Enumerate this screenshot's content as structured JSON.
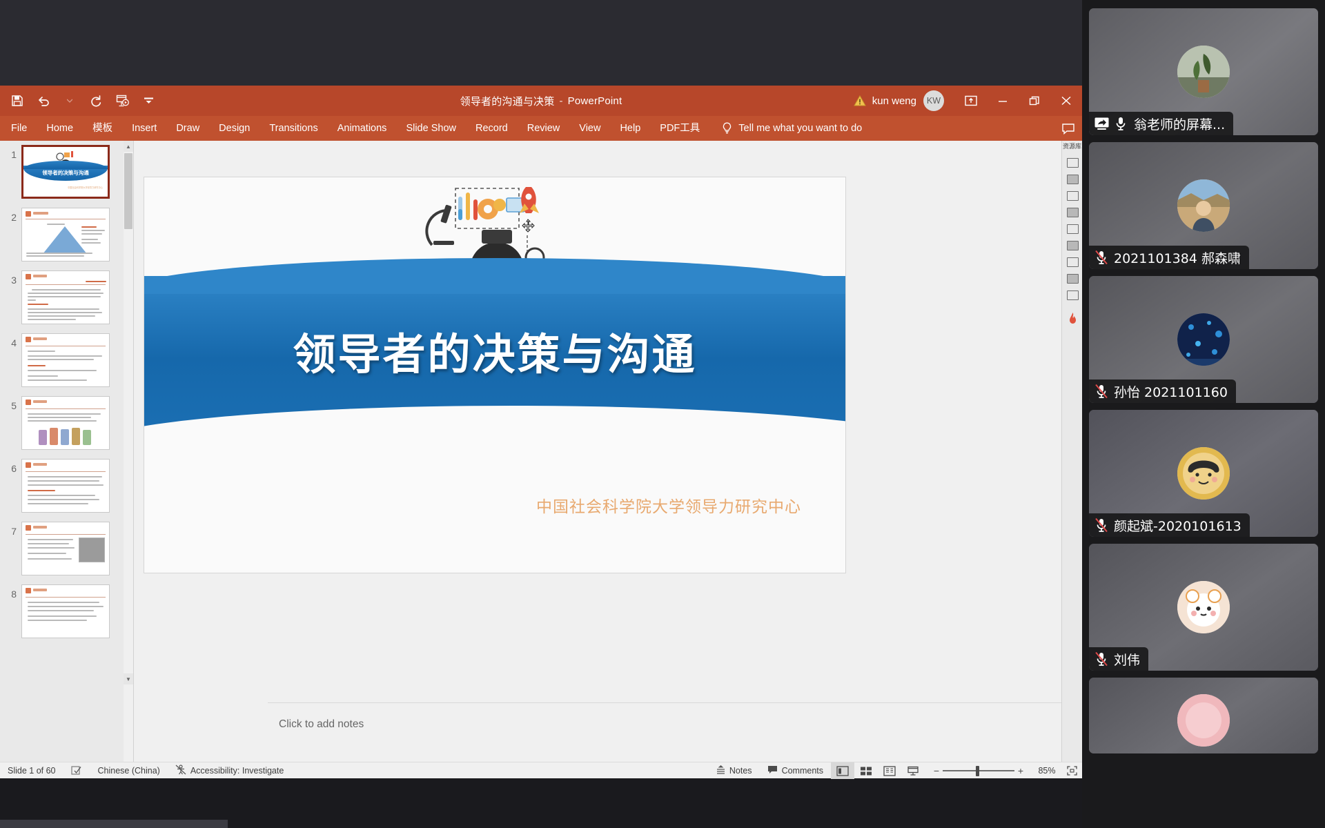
{
  "app": {
    "title": "领导者的沟通与决策",
    "separator": "-",
    "product": "PowerPoint",
    "accent": "#b7472a",
    "ribbon_color": "#c0512f"
  },
  "quick_access": [
    {
      "name": "save-icon",
      "label": "Save"
    },
    {
      "name": "undo-icon",
      "label": "Undo"
    },
    {
      "name": "redo-icon",
      "label": "Redo"
    },
    {
      "name": "start-presentation-icon",
      "label": "Start From Beginning"
    },
    {
      "name": "customize-quick-access-icon",
      "label": "Customize Quick Access Toolbar"
    }
  ],
  "window": {
    "warning_icon": "warning-triangle-icon",
    "user_name": "kun weng",
    "avatar_initials": "KW",
    "ribbon_display_options": "Ribbon Display Options",
    "minimize": "Minimize",
    "restore": "Restore Down",
    "close": "Close"
  },
  "ribbon": {
    "tabs": [
      "File",
      "Home",
      "模板",
      "Insert",
      "Draw",
      "Design",
      "Transitions",
      "Animations",
      "Slide Show",
      "Record",
      "Review",
      "View",
      "Help",
      "PDF工具"
    ],
    "tell_me": "Tell me what you want to do",
    "comments_button": "Comments"
  },
  "thumbnails": [
    {
      "number": "1",
      "kind": "title",
      "selected": true
    },
    {
      "number": "2",
      "kind": "pyramid",
      "selected": false
    },
    {
      "number": "3",
      "kind": "text",
      "selected": false
    },
    {
      "number": "4",
      "kind": "text2",
      "selected": false
    },
    {
      "number": "5",
      "kind": "people",
      "selected": false
    },
    {
      "number": "6",
      "kind": "text",
      "selected": false
    },
    {
      "number": "7",
      "kind": "photo",
      "selected": false
    },
    {
      "number": "8",
      "kind": "text",
      "selected": false
    }
  ],
  "slide": {
    "title": "领导者的决策与沟通",
    "subtitle": "中国社会科学院大学领导力研究中心",
    "title_color": "#ffffff",
    "subtitle_color": "#e8a96f",
    "band_color": "#1668ab"
  },
  "notes": {
    "placeholder": "Click to add notes"
  },
  "status": {
    "slide_counter": "Slide 1 of 60",
    "language": "Chinese (China)",
    "accessibility": "Accessibility: Investigate",
    "notes_button": "Notes",
    "comments_button": "Comments",
    "zoom_percent": "85%",
    "zoom_out": "−",
    "zoom_in": "+",
    "views": [
      {
        "name": "normal-view-button",
        "label": "Normal",
        "active": true
      },
      {
        "name": "slide-sorter-view-button",
        "label": "Slide Sorter",
        "active": false
      },
      {
        "name": "reading-view-button",
        "label": "Reading View",
        "active": false
      },
      {
        "name": "slide-show-button",
        "label": "Slide Show",
        "active": false
      }
    ],
    "fit_to_window": "Fit slide to current window"
  },
  "rail": {
    "label": "资源库",
    "items": [
      "template-icon",
      "grid-icon",
      "layout-icon",
      "image-icon",
      "chart-icon",
      "shapes-icon",
      "table-icon",
      "text-icon",
      "settings-icon",
      "flame-icon"
    ]
  },
  "zoom_meeting": {
    "participants": [
      {
        "name": "翁老师的屏幕...",
        "muted": false,
        "sharing": true,
        "mic_icon": "microphone-icon",
        "share_icon": "screen-share-icon",
        "avatar": "plant-photo"
      },
      {
        "name": "2021101384 郝森啸",
        "muted": true,
        "sharing": false,
        "mic_icon": "microphone-muted-icon",
        "avatar": "person-desert-photo"
      },
      {
        "name": "孙怡 2021101160",
        "muted": true,
        "sharing": false,
        "mic_icon": "microphone-muted-icon",
        "avatar": "blue-lights-photo"
      },
      {
        "name": "颜起斌-2020101613",
        "muted": true,
        "sharing": false,
        "mic_icon": "microphone-muted-icon",
        "avatar": "cartoon-face-avatar"
      },
      {
        "name": "刘伟",
        "muted": true,
        "sharing": false,
        "mic_icon": "microphone-muted-icon",
        "avatar": "cartoon-bear-avatar"
      },
      {
        "name": "",
        "muted": true,
        "sharing": false,
        "mic_icon": "microphone-muted-icon",
        "avatar": "pink-photo"
      }
    ]
  }
}
